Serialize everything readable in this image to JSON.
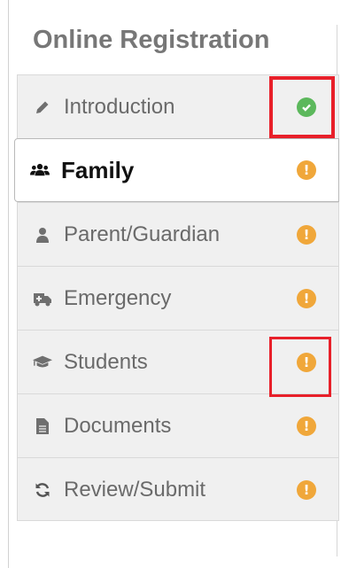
{
  "header": {
    "title": "Online Registration"
  },
  "nav": {
    "items": [
      {
        "label": "Introduction",
        "icon": "pencil-icon",
        "status": "complete"
      },
      {
        "label": "Family",
        "icon": "users-icon",
        "status": "warning"
      },
      {
        "label": "Parent/Guardian",
        "icon": "user-icon",
        "status": "warning"
      },
      {
        "label": "Emergency",
        "icon": "ambulance-icon",
        "status": "warning"
      },
      {
        "label": "Students",
        "icon": "graduation-cap-icon",
        "status": "warning"
      },
      {
        "label": "Documents",
        "icon": "file-icon",
        "status": "warning"
      },
      {
        "label": "Review/Submit",
        "icon": "refresh-icon",
        "status": "warning"
      }
    ]
  },
  "colors": {
    "warning": "#f0a73a",
    "complete": "#5cb85c",
    "highlight": "#e8202a",
    "muted_text": "#6a6a6a",
    "title_text": "#777777"
  }
}
